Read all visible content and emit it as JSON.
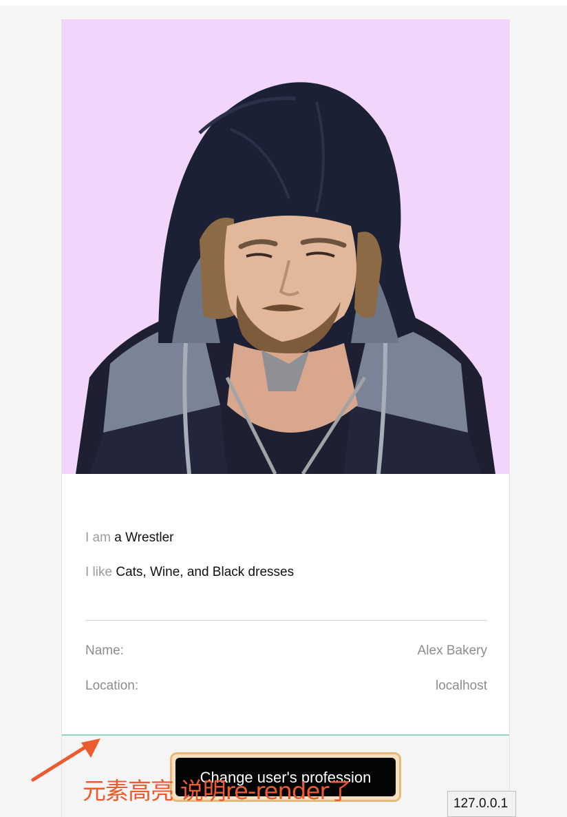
{
  "profile": {
    "photo_alt": "user-photo",
    "bio": {
      "profession_prefix": "I am",
      "profession": "a Wrestler",
      "likes_prefix": "I like",
      "likes": "Cats, Wine, and Black dresses"
    },
    "info": {
      "name_label": "Name:",
      "name_value": "Alex Bakery",
      "location_label": "Location:",
      "location_value": "localhost"
    }
  },
  "actions": {
    "change_profession_label": "Change user's profession"
  },
  "status_bar": {
    "url": "127.0.0.1"
  },
  "annotation": {
    "text": "元素高亮 说明re-render了"
  },
  "colors": {
    "photo_background": "#f1d5fa",
    "footer_border": "#8fd3c4",
    "highlight": "#e8b878",
    "annotation": "#ec5a2f"
  }
}
